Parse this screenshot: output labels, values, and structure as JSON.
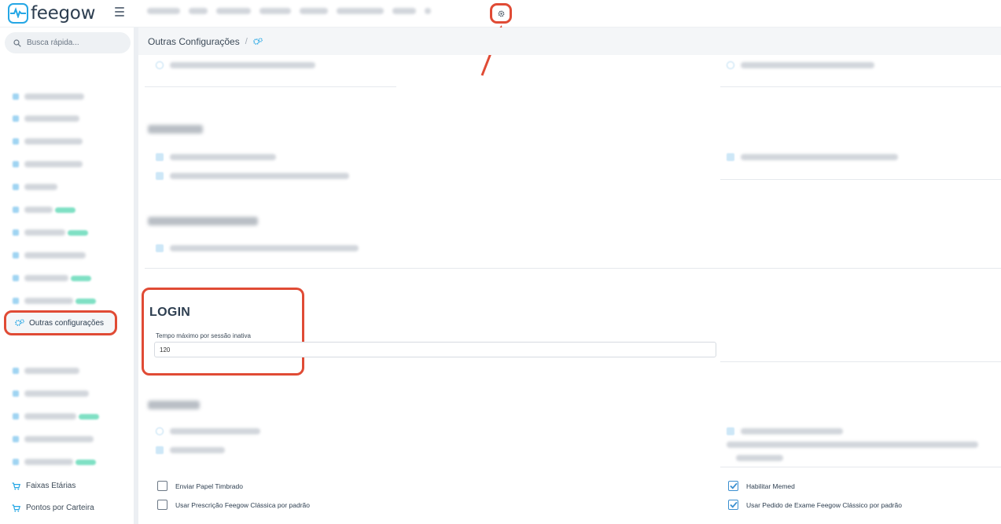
{
  "app": {
    "logo_text": "feegow"
  },
  "sidebar": {
    "search_placeholder": "Busca rápida...",
    "active_item": "Outras configurações",
    "bottom_items": [
      "Faixas Etárias",
      "Pontos por Carteira"
    ]
  },
  "breadcrumb": {
    "title": "Outras Configurações",
    "separator": "/"
  },
  "login": {
    "title": "LOGIN",
    "field_label": "Tempo máximo por sessão inativa",
    "field_value": "120"
  },
  "memed_options": {
    "left": [
      {
        "label": "Enviar Papel Timbrado",
        "checked": false
      },
      {
        "label": "Usar Prescrição Feegow Clássica por padrão",
        "checked": false
      }
    ],
    "right": [
      {
        "label": "Habilitar Memed",
        "checked": true
      },
      {
        "label": "Usar Pedido de Exame Feegow Clássico por padrão",
        "checked": true
      }
    ]
  },
  "colors": {
    "accent": "#25a7e5",
    "highlight": "#e04b35",
    "check": "#3a8fd0"
  }
}
